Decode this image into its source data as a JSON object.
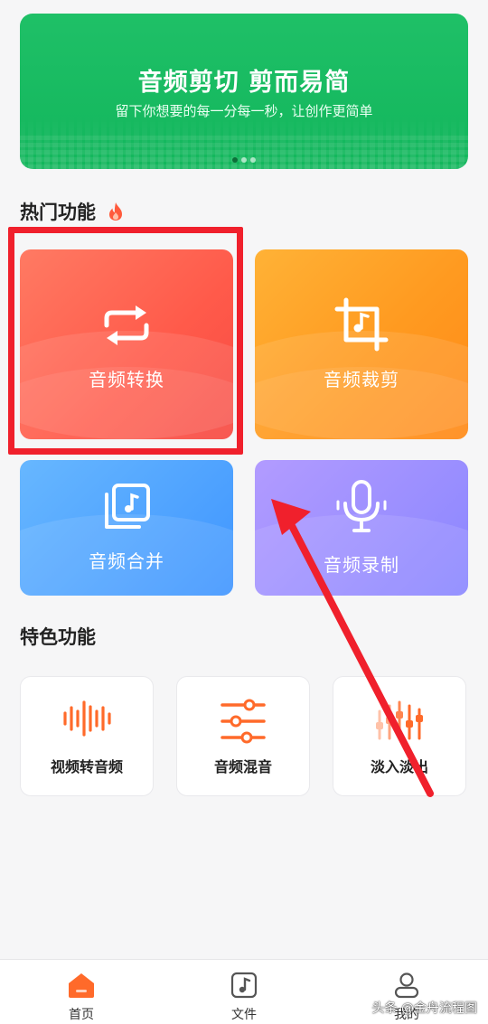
{
  "banner": {
    "title": "音频剪切 剪而易简",
    "subtitle": "留下你想要的每一分每一秒，让创作更简单",
    "dots": 3,
    "active_dot": 0,
    "color": "#15b85f"
  },
  "hot_section": {
    "title": "热门功能",
    "icon": "fire-icon",
    "cards": [
      {
        "label": "音频转换",
        "icon": "convert-arrows-icon",
        "color": "#ff5a4a"
      },
      {
        "label": "音频裁剪",
        "icon": "crop-music-icon",
        "color": "#ff9a20"
      },
      {
        "label": "音频合并",
        "icon": "merge-music-icon",
        "color": "#3f95ff"
      },
      {
        "label": "音频录制",
        "icon": "microphone-icon",
        "color": "#8a86ff"
      }
    ]
  },
  "feature_section": {
    "title": "特色功能",
    "items": [
      {
        "label": "视频转音频",
        "icon": "waveform-icon"
      },
      {
        "label": "音频混音",
        "icon": "mixer-sliders-icon"
      },
      {
        "label": "淡入淡出",
        "icon": "fade-sliders-icon"
      }
    ]
  },
  "tabbar": {
    "tabs": [
      {
        "label": "首页",
        "icon": "home-icon",
        "active": true
      },
      {
        "label": "文件",
        "icon": "music-file-icon",
        "active": false
      },
      {
        "label": "我的",
        "icon": "user-icon",
        "active": false
      }
    ]
  },
  "watermark": "头条 @金舟流程图",
  "annotation": {
    "highlight_color": "#f0202c"
  }
}
